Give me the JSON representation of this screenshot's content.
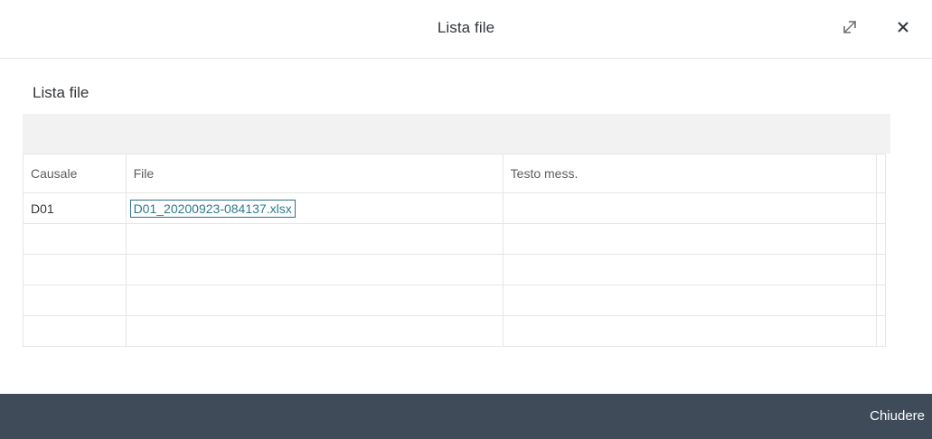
{
  "dialog": {
    "title": "Lista file",
    "expand_icon": "expand-icon",
    "close_icon": "close-icon"
  },
  "section": {
    "title": "Lista file"
  },
  "table": {
    "columns": [
      "Causale",
      "File",
      "Testo mess."
    ],
    "rows": [
      [
        "D01",
        "D01_20200923-084137.xlsx",
        ""
      ],
      [
        "",
        "",
        ""
      ],
      [
        "",
        "",
        ""
      ],
      [
        "",
        "",
        ""
      ],
      [
        "",
        "",
        ""
      ]
    ]
  },
  "footer": {
    "close_label": "Chiudere"
  },
  "colors": {
    "footer_bg": "#3f4b59",
    "link": "#2f7a8c",
    "toolbar_bg": "#f2f2f2"
  }
}
